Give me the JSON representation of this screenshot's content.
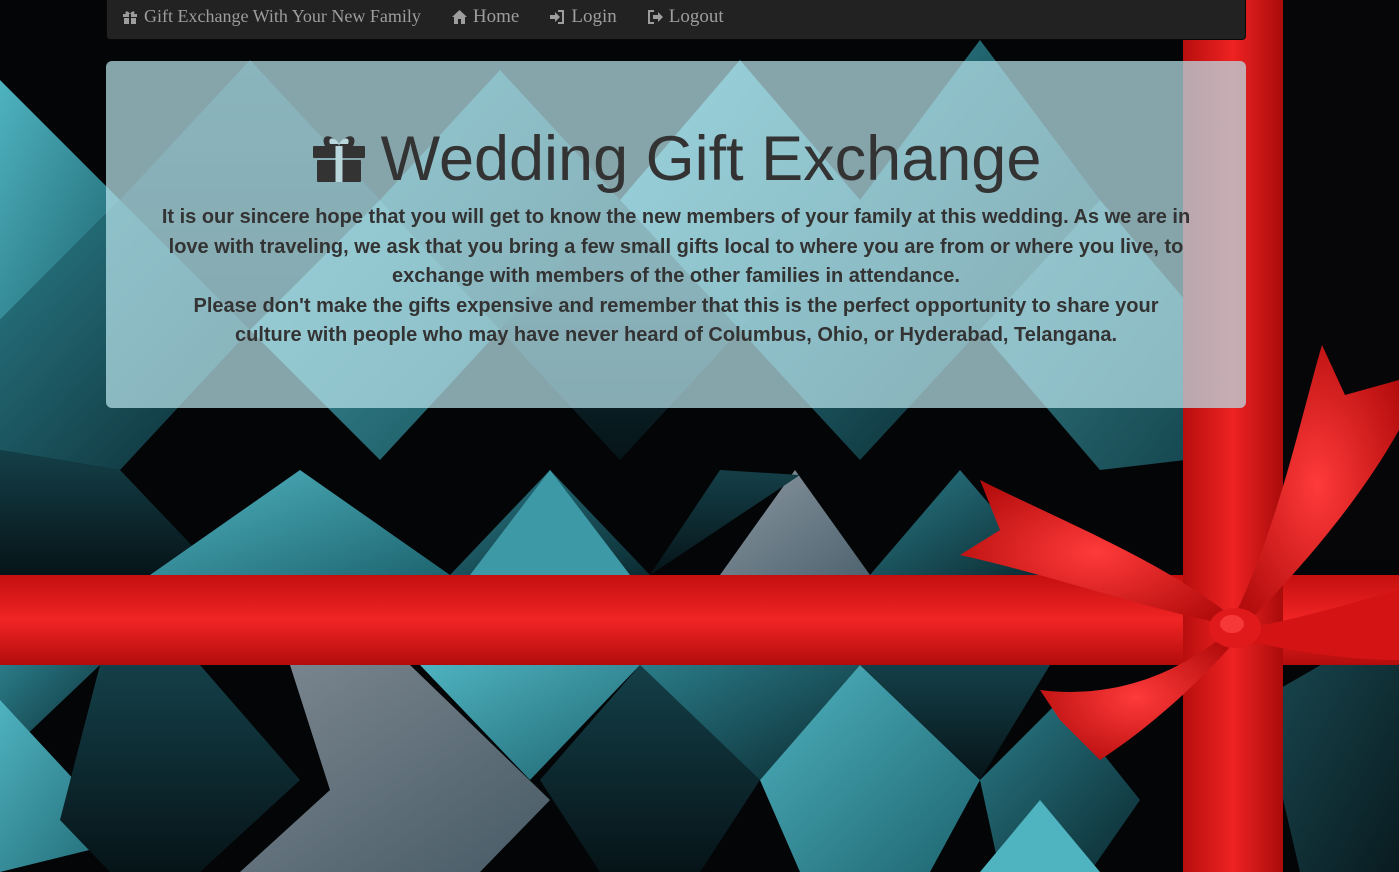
{
  "page": {
    "background_colors": [
      "#050608",
      "#3a8f9c",
      "#1a4a55",
      "#e81c1c"
    ]
  },
  "navbar": {
    "brand": {
      "label": "Gift Exchange With Your New Family",
      "icon": "gift-icon"
    },
    "items": [
      {
        "label": "Home",
        "icon": "home-icon"
      },
      {
        "label": "Login",
        "icon": "login-icon"
      },
      {
        "label": "Logout",
        "icon": "logout-icon"
      }
    ],
    "background": "#222222",
    "text_color": "#9d9d9d"
  },
  "jumbotron": {
    "title": "Wedding Gift Exchange",
    "title_icon": "gift-icon",
    "paragraph_1": "It is our sincere hope that you will get to know the new members of your family at this wedding. As we are in love with traveling, we ask that you bring a few small gifts local to where you are from or where you live, to exchange with members of the other families in attendance.",
    "paragraph_2": "Please don't make the gifts expensive and remember that this is the perfect opportunity to share your culture with people who may have never heard of Columbus, Ohio, or Hyderabad, Telangana.",
    "text_color": "#333333"
  }
}
